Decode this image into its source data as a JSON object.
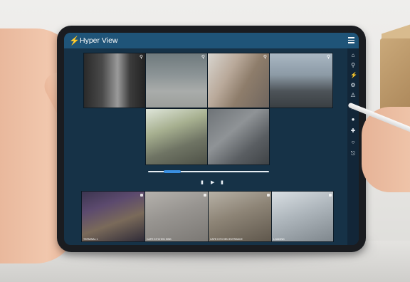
{
  "app": {
    "title": "Hyper View"
  },
  "icons": {
    "app_logo": "lightning-bolt-icon",
    "menu": "hamburger-menu-icon",
    "rail": [
      "home-icon",
      "search-icon",
      "lightning-icon",
      "gear-icon",
      "alert-icon",
      "flag-icon",
      "user-icon",
      "wrench-icon",
      "settings-icon",
      "power-icon"
    ]
  },
  "colors": {
    "titlebar": "#1f5478",
    "screen_bg": "#163247",
    "progress_accent": "#3a8fe0"
  },
  "player": {
    "progress": 0.2
  },
  "cameras_bottom": [
    {
      "label": "TERMINAL 1"
    },
    {
      "label": "CAFE KITCHEN SINK"
    },
    {
      "label": "CAFE KITCHEN ENTRANCE"
    },
    {
      "label": "LOADING"
    }
  ]
}
